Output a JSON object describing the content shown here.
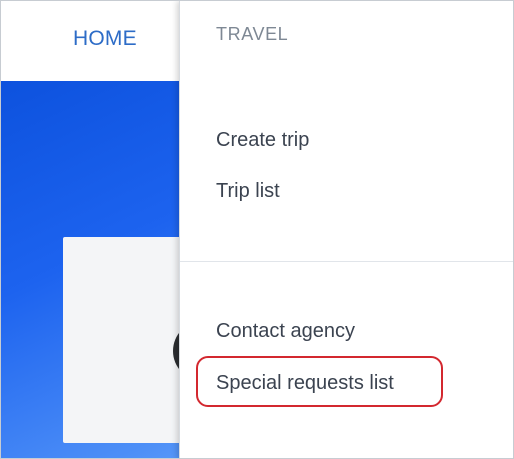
{
  "navigation": {
    "home_tab": "HOME"
  },
  "dropdown": {
    "header": "TRAVEL",
    "items": [
      {
        "label": "Create trip"
      },
      {
        "label": "Trip list"
      },
      {
        "label": "Contact agency"
      },
      {
        "label": "Special requests list"
      }
    ]
  },
  "colors": {
    "nav_accent": "#2d6cc7",
    "menu_text": "#3b4350",
    "header_text": "#7e8894",
    "highlight": "#d3282f"
  }
}
